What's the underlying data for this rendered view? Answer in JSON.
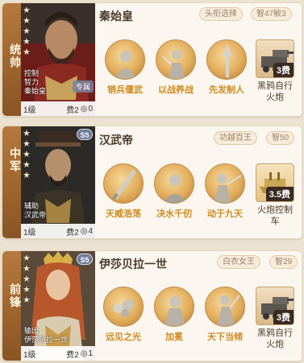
{
  "cards": [
    {
      "role": "统帅",
      "portrait_sub": [
        "控制",
        "智力",
        "秦始皇"
      ],
      "portrait_tag": "专属",
      "level": "1级",
      "cost": "费2",
      "cost_icon_count": "0",
      "name": "秦始皇",
      "pill1": "头衔选择",
      "pill2": "智47敏3",
      "skills": [
        "销兵偃武",
        "以战养战",
        "先发制人"
      ],
      "tactic": {
        "fee": "3费",
        "label_l1": "黑鸦自行",
        "label_l2": "火炮"
      }
    },
    {
      "role": "中军",
      "portrait_sub": [
        "辅助",
        "汉武帝"
      ],
      "level": "1级",
      "cost": "费2",
      "cost_icon_count": "4",
      "name": "汉武帝",
      "pill1": "功越百王",
      "pill2": "智50",
      "skills": [
        "天威浩荡",
        "决水千仞",
        "动于九天"
      ],
      "tactic": {
        "fee": "3.5费",
        "label_l1": "火炮控制",
        "label_l2": "车"
      }
    },
    {
      "role": "前锋",
      "portrait_sub": [
        "输出",
        "伊莎贝拉一世"
      ],
      "level": "1级",
      "cost": "费2",
      "cost_icon_count": "1",
      "name": "伊莎贝拉一世",
      "pill1": "白衣女王",
      "pill2": "智29",
      "skills": [
        "远见之光",
        "加冕",
        "天下当倾"
      ],
      "tactic": {
        "fee": "3费",
        "label_l1": "黑鸦自行",
        "label_l2": "火炮"
      }
    }
  ],
  "badge_s5": "S5",
  "colors": {
    "accent": "#d08a1c",
    "role_bar": "#a86b32",
    "card_bg": "#fbf7f0"
  }
}
